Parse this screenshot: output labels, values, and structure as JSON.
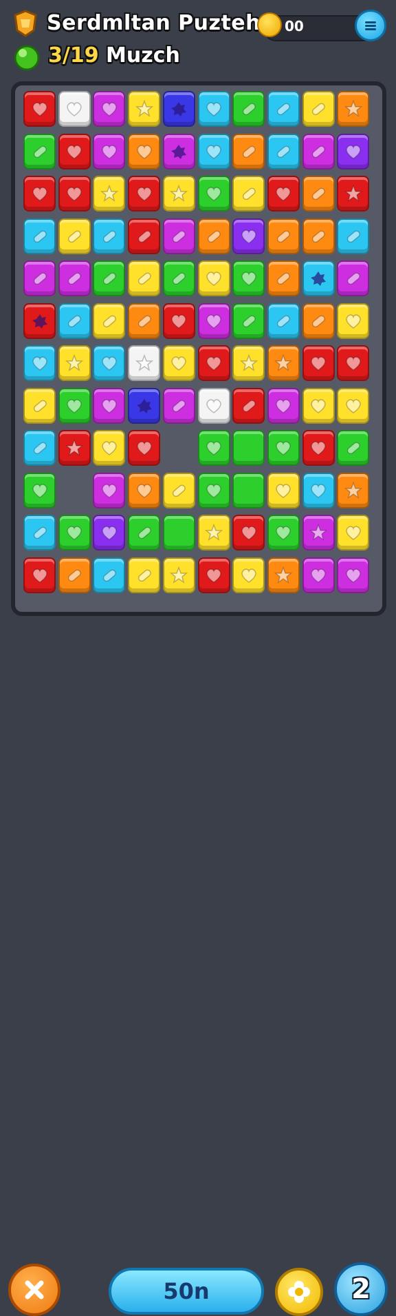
{
  "header": {
    "title": "Serdmltan Puzteh",
    "level_number": "3/19",
    "level_label": "Muzch",
    "coins": "00",
    "menu_icon": "menu-icon"
  },
  "colors": {
    "r": "#e01a1a",
    "o": "#ff8a12",
    "y": "#ffe02a",
    "g": "#2ccf2c",
    "c": "#2cc6f2",
    "b": "#3a38e6",
    "p": "#cc2ee0",
    "u": "#8a2ef0",
    "w": "#f4f4f4"
  },
  "board": {
    "rows": [
      [
        "r:heart",
        "w:heart",
        "p:heart",
        "y:star",
        "b:blob",
        "c:heart",
        "g:bar",
        "c:bar",
        "y:bar",
        "o:star"
      ],
      [
        "g:bar",
        "r:heart",
        "p:heart",
        "o:heart",
        "p:blob",
        "c:heart",
        "o:bar",
        "c:bar",
        "p:bar",
        "u:heart"
      ],
      [
        "r:heart",
        "r:heart",
        "y:star",
        "r:heart",
        "y:star",
        "g:heart",
        "y:bar",
        "r:heart",
        "o:bar",
        "r:star"
      ],
      [
        "c:bar",
        "y:bar",
        "c:bar",
        "r:bar",
        "p:bar",
        "o:bar",
        "u:heart",
        "o:bar",
        "o:bar",
        "c:bar"
      ],
      [
        "p:bar",
        "p:bar",
        "g:bar",
        "y:bar",
        "g:bar",
        "y:heart",
        "g:heart",
        "o:bar",
        "c:blob",
        "p:bar"
      ],
      [
        "r:blob",
        "c:bar",
        "y:bar",
        "o:bar",
        "r:heart",
        "p:heart",
        "g:bar",
        "c:bar",
        "o:bar",
        "y:heart"
      ],
      [
        "c:heart",
        "y:star",
        "c:heart",
        "w:star",
        "y:heart",
        "r:heart",
        "y:star",
        "o:star",
        "r:heart",
        "r:heart"
      ],
      [
        "y:bar",
        "g:heart",
        "p:heart",
        "b:blob",
        "p:bar",
        "w:heart",
        "r:bar",
        "p:heart",
        "y:heart",
        "y:heart"
      ],
      [
        "c:bar",
        "r:star",
        "y:heart",
        "r:heart",
        "",
        "g:heart",
        "g:plain",
        "g:heart",
        "r:heart",
        "g:bar"
      ],
      [
        "g:heart",
        "",
        "p:heart",
        "o:heart",
        "y:bar",
        "g:heart",
        "g:plain",
        "y:heart",
        "c:heart",
        "o:star"
      ],
      [
        "c:bar",
        "g:heart",
        "u:heart",
        "g:bar",
        "g:plain",
        "y:star",
        "r:heart",
        "g:heart",
        "p:star",
        "y:heart"
      ],
      [
        "r:heart",
        "o:bar",
        "c:bar",
        "y:bar",
        "y:star",
        "r:heart",
        "y:heart",
        "o:star",
        "p:heart",
        "p:heart"
      ]
    ]
  },
  "footer": {
    "close_icon": "close-icon",
    "score_label": "50n",
    "flower_icon": "flower-icon",
    "count": "2"
  }
}
